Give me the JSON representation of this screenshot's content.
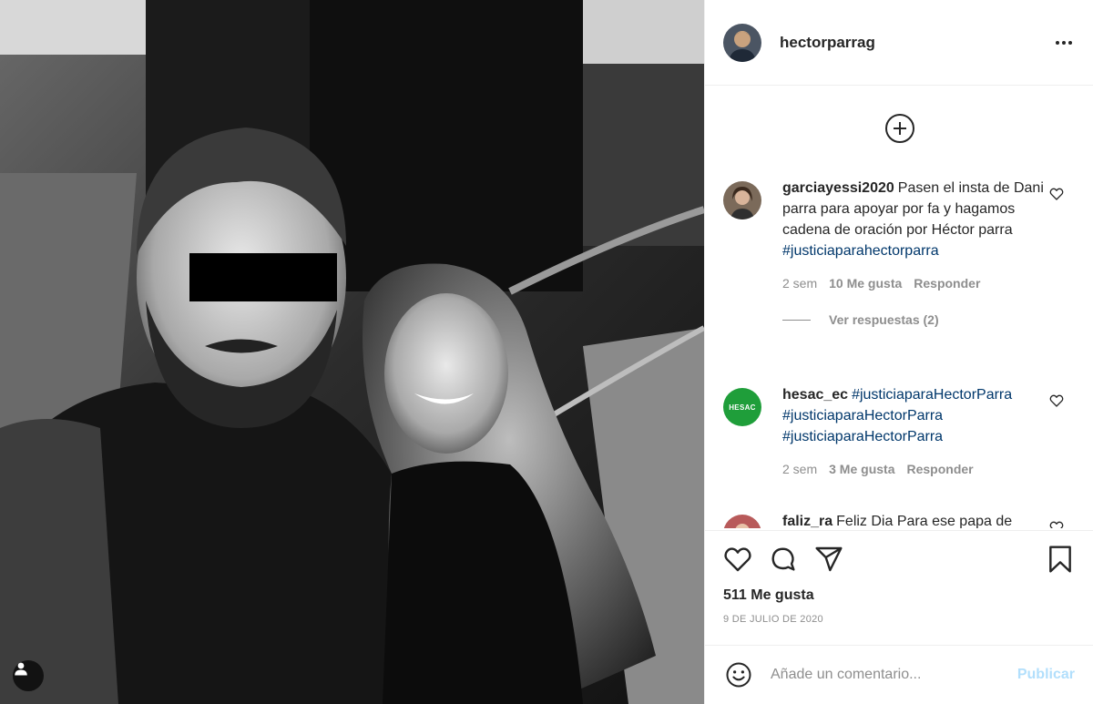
{
  "post": {
    "username": "hectorparrag",
    "likes_text": "511 Me gusta",
    "date_text": "9 DE JULIO DE 2020"
  },
  "comments": [
    {
      "user": "garciayessi2020",
      "text": "Pasen el insta de Dani parra para apoyar por fa y hagamos cadena de oración por Héctor parra",
      "hashtag": "#justiciaparahectorparra",
      "time": "2 sem",
      "likes": "10 Me gusta",
      "reply": "Responder",
      "view_replies": "Ver respuestas (2)"
    },
    {
      "user": "hesac_ec",
      "avatar_text": "HESAC",
      "hashtags": [
        "#justiciaparaHectorParra",
        "#justiciaparaHectorParra",
        "#justiciaparaHectorParra"
      ],
      "time": "2 sem",
      "likes": "3 Me gusta",
      "reply": "Responder"
    },
    {
      "user": "faliz_ra",
      "text": "Feliz Dia Para ese papa de"
    }
  ],
  "add_comment": {
    "placeholder": "Añade un comentario...",
    "publish_label": "Publicar"
  },
  "icons": {
    "more": "more-horizontal-icon",
    "load_more": "plus-circle-icon",
    "like": "heart-icon",
    "comment": "comment-icon",
    "share": "paper-plane-icon",
    "save": "bookmark-icon",
    "emoji": "smiley-icon",
    "tagged_user": "user-tag-icon"
  },
  "colors": {
    "hashtag": "#00376b",
    "secondary_text": "#8e8e8e",
    "publish_disabled": "#b2dffc",
    "hesac_avatar": "#1f9e3a"
  }
}
